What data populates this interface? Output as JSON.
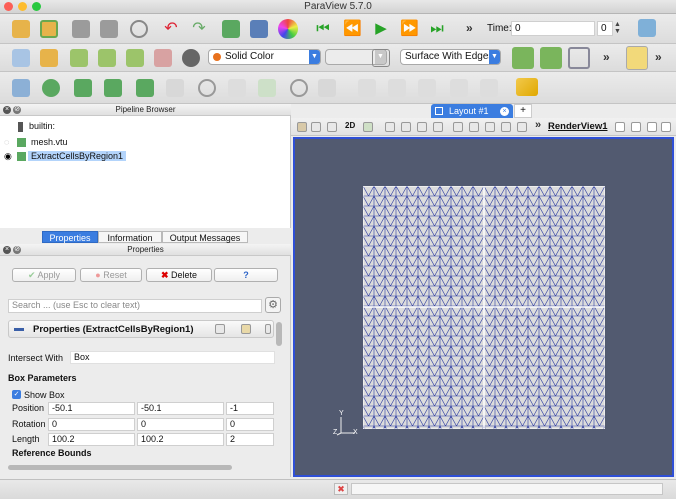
{
  "window": {
    "title": "ParaView 5.7.0"
  },
  "toolbar1": {
    "time_label": "Time:",
    "time_value": "0",
    "time_index": "0"
  },
  "toolbar2": {
    "color_combo": "Solid Color",
    "representation_combo": "Surface With Edges"
  },
  "toolbar3": {
    "twod_label": "2D"
  },
  "pipeline": {
    "title": "Pipeline Browser",
    "items": [
      {
        "label": "builtin:"
      },
      {
        "label": "mesh.vtu"
      },
      {
        "label": "ExtractCellsByRegion1"
      }
    ]
  },
  "tabs": {
    "properties": "Properties",
    "information": "Information",
    "output": "Output Messages"
  },
  "properties": {
    "title": "Properties",
    "apply": "Apply",
    "reset": "Reset",
    "delete": "Delete",
    "help": "?",
    "search_placeholder": "Search ... (use Esc to clear text)",
    "section_title": "Properties (ExtractCellsByRegion1)",
    "intersect_label": "Intersect With",
    "intersect_value": "Box",
    "box_params": "Box Parameters",
    "show_box": "Show Box",
    "position_label": "Position",
    "position": [
      "-50.1",
      "-50.1",
      "-1"
    ],
    "rotation_label": "Rotation",
    "rotation": [
      "0",
      "0",
      "0"
    ],
    "length_label": "Length",
    "length": [
      "100.2",
      "100.2",
      "2"
    ],
    "ref_bounds": "Reference Bounds"
  },
  "layout": {
    "tab_label": "Layout #1",
    "add_tab": "+",
    "view_name": "RenderView1",
    "twod": "2D"
  },
  "axes": {
    "y": "Y",
    "z": "Z",
    "x": "X"
  },
  "colors": {
    "view_bg": "#525a70",
    "mesh_fill": "#dcdcdc",
    "mesh_edge": "#2b3aa0",
    "accent": "#3b7de0"
  }
}
